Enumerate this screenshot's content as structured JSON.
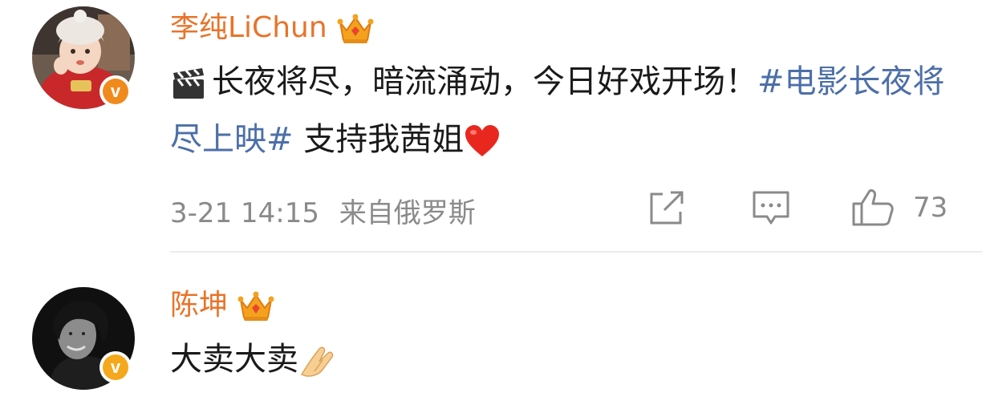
{
  "colors": {
    "username": "#e8742a",
    "topic": "#4d6fa8",
    "meta": "#8a8a8a",
    "badge_orange": "#f08a1d",
    "badge_gold": "#f5a81b"
  },
  "comments": [
    {
      "username": "李纯LiChun",
      "badge_icon": "crown-icon",
      "verified_icon": "verified-v-icon",
      "text_prefix": "长夜将尽，暗流涌动，今日好戏开场！",
      "topic": "#电影长夜将尽上映#",
      "text_suffix": " 支持我茜姐",
      "emoji_start": "clapper-board-icon",
      "emoji_end": "heart-icon",
      "timestamp": "3-21 14:15",
      "source": "来自俄罗斯",
      "likes": "73",
      "actions": [
        "share-icon",
        "comment-icon",
        "like-icon"
      ]
    },
    {
      "username": "陈坤",
      "badge_icon": "crown-icon",
      "verified_icon": "verified-v-icon",
      "text": "大卖大卖",
      "emoji_end": "palms-together-icon"
    }
  ]
}
